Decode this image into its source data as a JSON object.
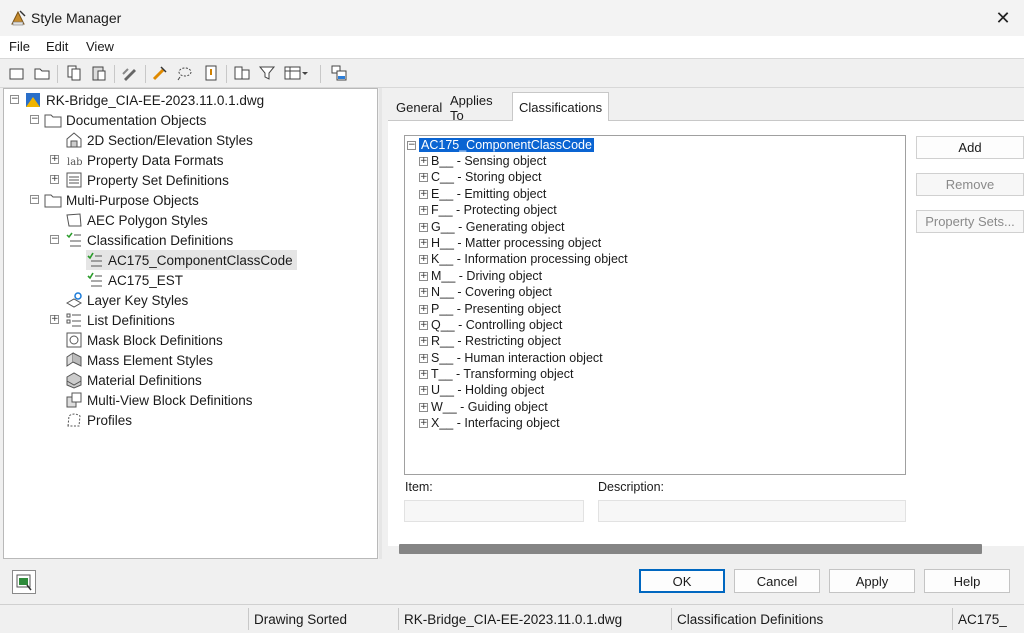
{
  "window": {
    "title": "Style Manager"
  },
  "menu": [
    "File",
    "Edit",
    "View"
  ],
  "tree": {
    "root": "RK-Bridge_CIA-EE-2023.11.0.1.dwg",
    "documentation": "Documentation Objects",
    "section": "2D Section/Elevation Styles",
    "propdata": "Property Data Formats",
    "propset": "Property Set Definitions",
    "multipurpose": "Multi-Purpose Objects",
    "aecpoly": "AEC Polygon Styles",
    "classdef": "Classification Definitions",
    "ac175cc": "AC175_ComponentClassCode",
    "ac175est": "AC175_EST",
    "layerkey": "Layer Key Styles",
    "listdef": "List Definitions",
    "maskblock": "Mask Block Definitions",
    "masselem": "Mass Element Styles",
    "material": "Material Definitions",
    "multiview": "Multi-View Block Definitions",
    "profiles": "Profiles"
  },
  "tabs": [
    "General",
    "Applies To",
    "Classifications"
  ],
  "classifications": {
    "root": "AC175_ComponentClassCode",
    "items": [
      "B__ - Sensing object",
      "C__ - Storing object",
      "E__ - Emitting object",
      "F__ - Protecting object",
      "G__ - Generating object",
      "H__ - Matter processing object",
      "K__ - Information processing object",
      "M__ - Driving object",
      "N__ - Covering object",
      "P__ - Presenting object",
      "Q__ - Controlling object",
      "R__ - Restricting object",
      "S__ - Human interaction object",
      "T__ - Transforming object",
      "U__ - Holding object",
      "W__ - Guiding object",
      "X__ - Interfacing object"
    ]
  },
  "side_buttons": {
    "add": "Add",
    "remove": "Remove",
    "property_sets": "Property Sets..."
  },
  "fields": {
    "item_label": "Item:",
    "description_label": "Description:",
    "item_value": "",
    "description_value": ""
  },
  "buttons": {
    "ok": "OK",
    "cancel": "Cancel",
    "apply": "Apply",
    "help": "Help"
  },
  "status": {
    "sorted": "Drawing Sorted",
    "file": "RK-Bridge_CIA-EE-2023.11.0.1.dwg",
    "category": "Classification Definitions",
    "item": "AC175_"
  },
  "colors": {
    "selection": "#0a64d2",
    "accent": "#0067c0"
  }
}
